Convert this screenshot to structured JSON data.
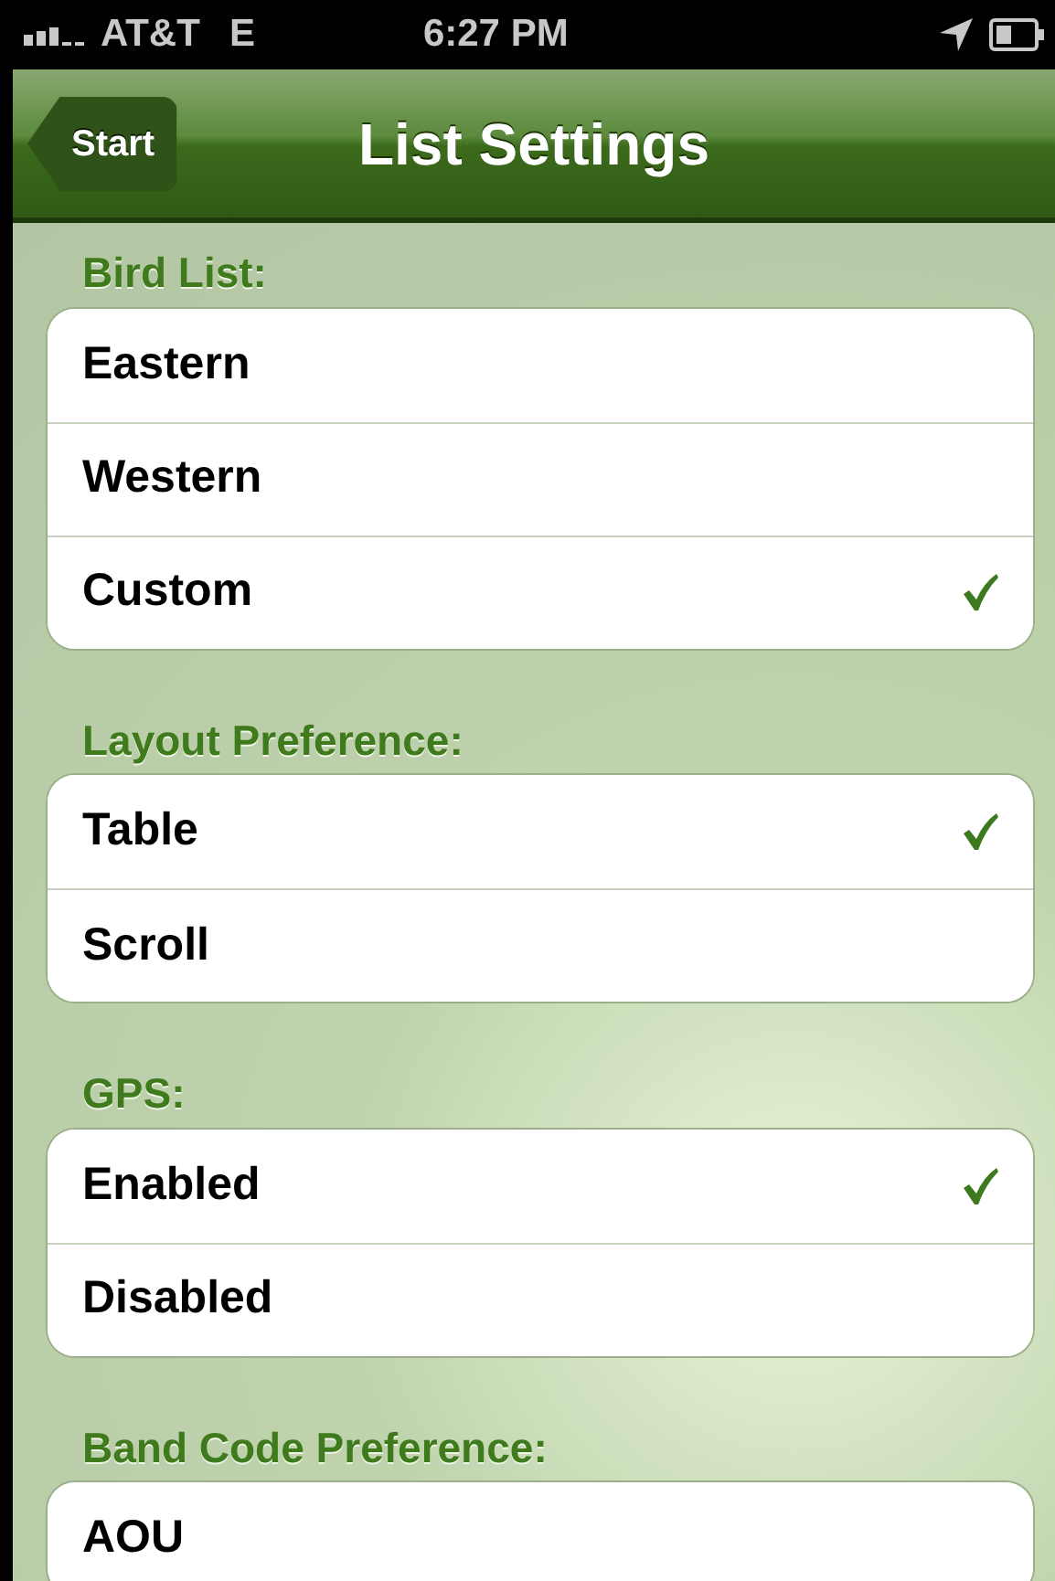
{
  "status_bar": {
    "carrier": "AT&T",
    "network": "E",
    "time": "6:27 PM"
  },
  "nav_bar": {
    "back_button": "Start",
    "title": "List Settings"
  },
  "sections": [
    {
      "header": "Bird List:",
      "options": [
        {
          "label": "Eastern",
          "selected": false
        },
        {
          "label": "Western",
          "selected": false
        },
        {
          "label": "Custom",
          "selected": true
        }
      ]
    },
    {
      "header": "Layout Preference:",
      "options": [
        {
          "label": "Table",
          "selected": true
        },
        {
          "label": "Scroll",
          "selected": false
        }
      ]
    },
    {
      "header": "GPS:",
      "options": [
        {
          "label": "Enabled",
          "selected": true
        },
        {
          "label": "Disabled",
          "selected": false
        }
      ]
    },
    {
      "header": "Band Code Preference:",
      "options": [
        {
          "label": "AOU",
          "selected": false
        }
      ]
    }
  ]
}
